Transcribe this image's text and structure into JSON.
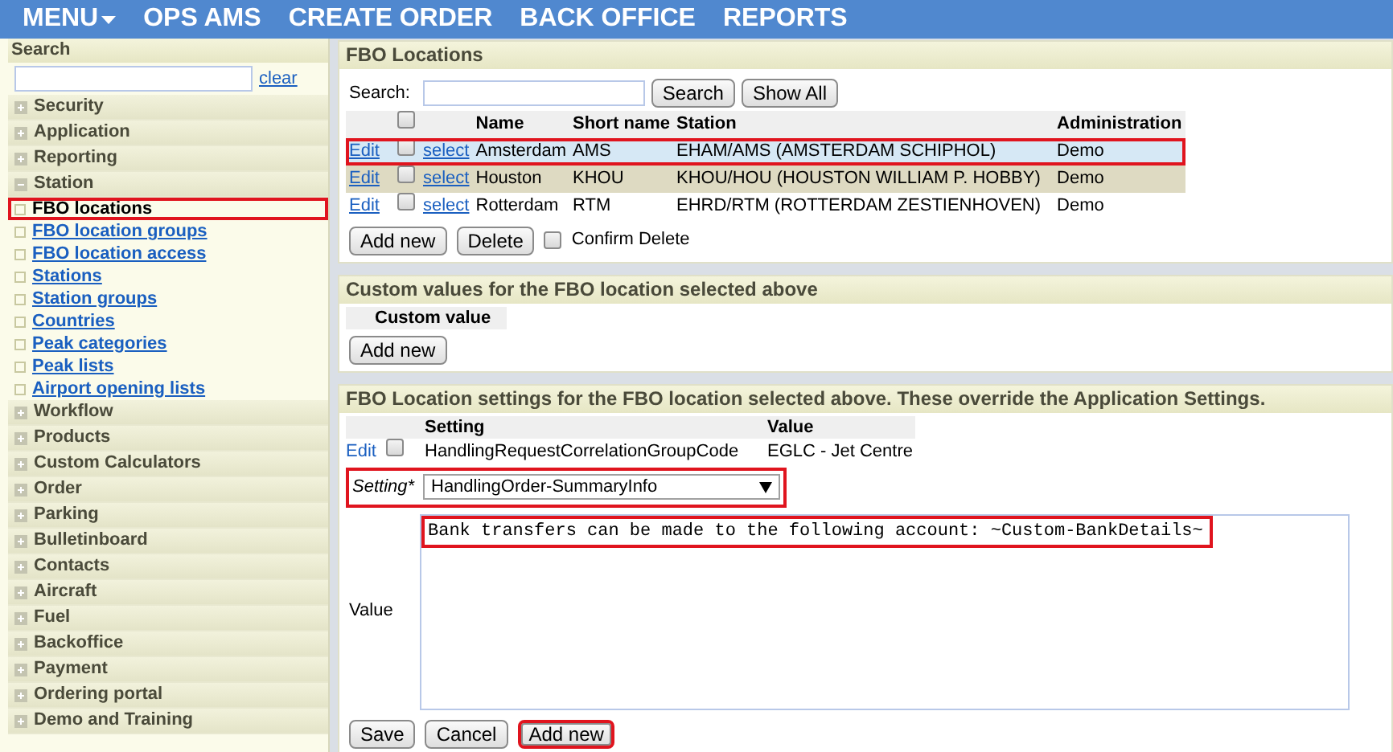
{
  "menu": [
    {
      "label": "MENU",
      "dropdown": true
    },
    {
      "label": "OPS AMS",
      "dropdown": false
    },
    {
      "label": "CREATE ORDER",
      "dropdown": false
    },
    {
      "label": "BACK OFFICE",
      "dropdown": false
    },
    {
      "label": "REPORTS",
      "dropdown": false
    }
  ],
  "sidebar": {
    "title": "Search",
    "clear": "clear",
    "sections": [
      {
        "label": "Security",
        "expanded": false
      },
      {
        "label": "Application",
        "expanded": false
      },
      {
        "label": "Reporting",
        "expanded": false
      },
      {
        "label": "Station",
        "expanded": true,
        "children": [
          {
            "label": "FBO locations",
            "selected": true,
            "highlighted": true
          },
          {
            "label": "FBO location groups",
            "selected": false,
            "highlighted": false
          },
          {
            "label": "FBO location access",
            "selected": false,
            "highlighted": false
          },
          {
            "label": "Stations",
            "selected": false,
            "highlighted": false
          },
          {
            "label": "Station groups",
            "selected": false,
            "highlighted": false
          },
          {
            "label": "Countries",
            "selected": false,
            "highlighted": false
          },
          {
            "label": "Peak categories",
            "selected": false,
            "highlighted": false
          },
          {
            "label": "Peak lists",
            "selected": false,
            "highlighted": false
          },
          {
            "label": "Airport opening lists",
            "selected": false,
            "highlighted": false
          }
        ]
      },
      {
        "label": "Workflow",
        "expanded": false
      },
      {
        "label": "Products",
        "expanded": false
      },
      {
        "label": "Custom Calculators",
        "expanded": false
      },
      {
        "label": "Order",
        "expanded": false
      },
      {
        "label": "Parking",
        "expanded": false
      },
      {
        "label": "Bulletinboard",
        "expanded": false
      },
      {
        "label": "Contacts",
        "expanded": false
      },
      {
        "label": "Aircraft",
        "expanded": false
      },
      {
        "label": "Fuel",
        "expanded": false
      },
      {
        "label": "Backoffice",
        "expanded": false
      },
      {
        "label": "Payment",
        "expanded": false
      },
      {
        "label": "Ordering portal",
        "expanded": false
      },
      {
        "label": "Demo and Training",
        "expanded": false
      }
    ]
  },
  "fbo_locations": {
    "title": "FBO Locations",
    "search_label": "Search:",
    "search_buttons": [
      "Search",
      "Show All"
    ],
    "columns": [
      "Name",
      "Short name",
      "Station",
      "Administration"
    ],
    "select_all_checked": false,
    "rows": [
      {
        "edit": "Edit",
        "select": "select",
        "name": "Amsterdam",
        "short_name": "AMS",
        "station": "EHAM/AMS (AMSTERDAM SCHIPHOL)",
        "administration": "Demo",
        "selected": true,
        "checked": false,
        "highlighted": true
      },
      {
        "edit": "Edit",
        "select": "select",
        "name": "Houston",
        "short_name": "KHOU",
        "station": "KHOU/HOU (HOUSTON WILLIAM P. HOBBY)",
        "administration": "Demo",
        "selected": false,
        "checked": false,
        "highlighted": false
      },
      {
        "edit": "Edit",
        "select": "select",
        "name": "Rotterdam",
        "short_name": "RTM",
        "station": "EHRD/RTM (ROTTERDAM ZESTIENHOVEN)",
        "administration": "Demo",
        "selected": false,
        "checked": false,
        "highlighted": false
      }
    ],
    "actions": [
      "Add new",
      "Delete"
    ],
    "confirm_delete": {
      "label": "Confirm Delete",
      "checked": false
    }
  },
  "custom_values": {
    "title": "Custom values for the FBO location selected above",
    "column": "Custom value",
    "button": "Add new"
  },
  "settings": {
    "title": "FBO Location settings for the FBO location selected above. These override the Application Settings.",
    "columns": [
      "Setting",
      "Value"
    ],
    "rows": [
      {
        "edit": "Edit",
        "setting": "HandlingRequestCorrelationGroupCode",
        "value": "EGLC - Jet Centre",
        "checked": false
      }
    ],
    "form": {
      "setting_label": "Setting*",
      "setting_value": "HandlingOrder-SummaryInfo",
      "setting_highlighted": true,
      "value_label": "Value",
      "value_text": "Bank transfers can be made to the following account: ~Custom-BankDetails~",
      "value_highlighted": true,
      "buttons": [
        {
          "label": "Save",
          "highlighted": false
        },
        {
          "label": "Cancel",
          "highlighted": false
        },
        {
          "label": "Add new",
          "highlighted": true
        }
      ]
    }
  }
}
